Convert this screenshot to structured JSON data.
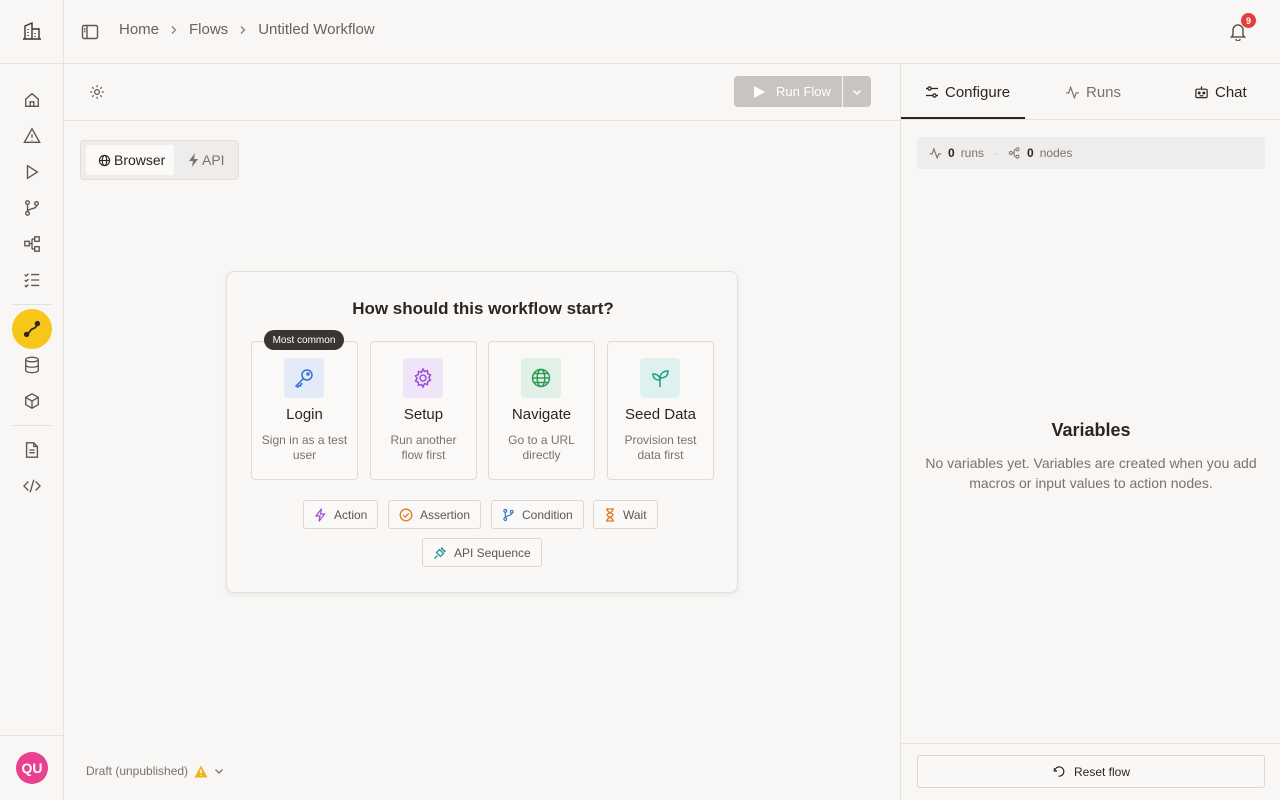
{
  "header": {
    "breadcrumb": [
      "Home",
      "Flows",
      "Untitled Workflow"
    ],
    "notification_count": "9"
  },
  "toolbar": {
    "run_label": "Run Flow"
  },
  "mode_toggle": {
    "browser_label": "Browser",
    "api_label": "API"
  },
  "start_card": {
    "title": "How should this workflow start?",
    "badge": "Most common",
    "options": [
      {
        "title": "Login",
        "desc": "Sign in as a test user",
        "icon": "key-icon",
        "color": "#3b6fd4"
      },
      {
        "title": "Setup",
        "desc": "Run another flow first",
        "icon": "gear-icon",
        "color": "#9b4fd3"
      },
      {
        "title": "Navigate",
        "desc": "Go to a URL directly",
        "icon": "globe-icon",
        "color": "#2f9a55"
      },
      {
        "title": "Seed Data",
        "desc": "Provision test data first",
        "icon": "sprout-icon",
        "color": "#1f9b8a"
      }
    ],
    "chips": [
      "Action",
      "Assertion",
      "Condition",
      "Wait",
      "API Sequence"
    ]
  },
  "status": {
    "label": "Draft (unpublished)"
  },
  "panel": {
    "tabs": [
      "Configure",
      "Runs",
      "Chat"
    ],
    "stats": {
      "runs_count": "0",
      "runs_label": "runs",
      "nodes_count": "0",
      "nodes_label": "nodes"
    },
    "variables_title": "Variables",
    "variables_desc": "No variables yet. Variables are created when you add macros or input values to action nodes.",
    "reset_label": "Reset flow"
  },
  "user": {
    "initials": "QU"
  },
  "colors": {
    "accent": "#f6c71a",
    "avatar": "#e9408f",
    "badge": "#e53e3e"
  }
}
